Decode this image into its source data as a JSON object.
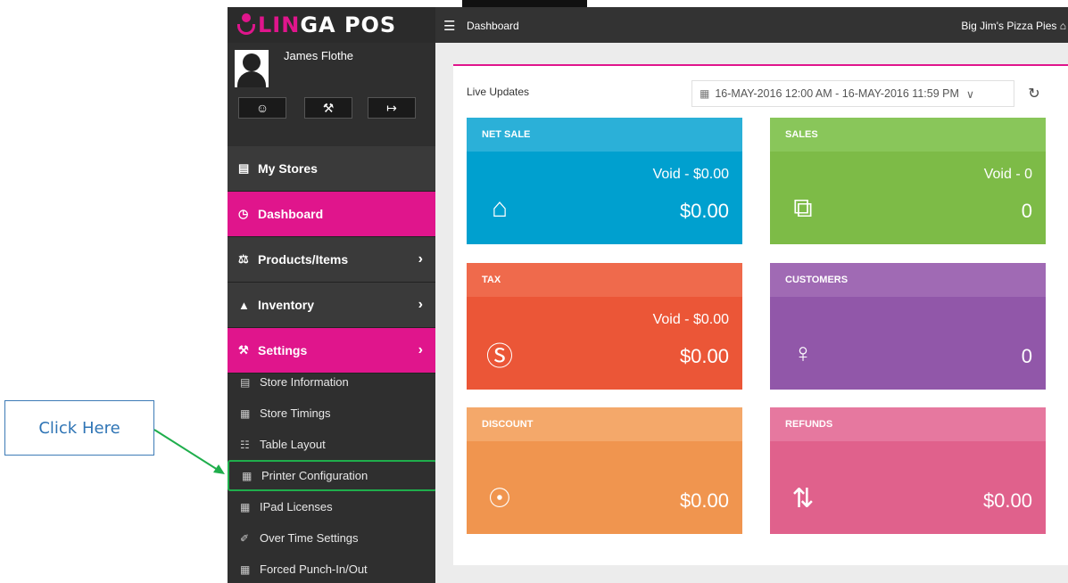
{
  "brand": {
    "part1": "LIN",
    "part2": "GA POS"
  },
  "user": {
    "name": "James Flothe",
    "buttons": [
      "profile",
      "settings",
      "logout"
    ]
  },
  "nav": [
    {
      "label": "My Stores",
      "icon": "store-icon",
      "glyph": "▤",
      "style": "dark",
      "chevron": false
    },
    {
      "label": "Dashboard",
      "icon": "dashboard-icon",
      "glyph": "◷",
      "style": "pink",
      "chevron": false
    },
    {
      "label": "Products/Items",
      "icon": "basket-icon",
      "glyph": "⚖",
      "style": "dark",
      "chevron": true
    },
    {
      "label": "Inventory",
      "icon": "inventory-icon",
      "glyph": "▲",
      "style": "dark",
      "chevron": true
    },
    {
      "label": "Settings",
      "icon": "wrench-icon",
      "glyph": "⚒",
      "style": "pink",
      "chevron": true
    }
  ],
  "settings_submenu": [
    {
      "label": "Store Information",
      "icon": "store-info-icon",
      "glyph": "▤"
    },
    {
      "label": "Store Timings",
      "icon": "timings-icon",
      "glyph": "▦"
    },
    {
      "label": "Table Layout",
      "icon": "table-icon",
      "glyph": "☷"
    },
    {
      "label": "Printer Configuration",
      "icon": "printer-icon",
      "glyph": "▦"
    },
    {
      "label": "IPad Licenses",
      "icon": "ipad-icon",
      "glyph": "▦"
    },
    {
      "label": "Over Time Settings",
      "icon": "overtime-icon",
      "glyph": "✐"
    },
    {
      "label": "Forced Punch-In/Out",
      "icon": "punch-icon",
      "glyph": "▦"
    }
  ],
  "topbar": {
    "breadcrumb": "Dashboard",
    "store": "Big Jim's Pizza Pies"
  },
  "dashboard": {
    "live_updates": "Live Updates",
    "date_range": "16-MAY-2016 12:00 AM - 16-MAY-2016 11:59 PM"
  },
  "cards": [
    {
      "title": "NET SALE",
      "void": "Void - $0.00",
      "amount": "$0.00",
      "head": "#2bb0d8",
      "body": "#00a0cf",
      "icon": "cloche-icon",
      "glyph": "⌂"
    },
    {
      "title": "SALES",
      "void": "Void - 0",
      "amount": "0",
      "head": "#89c65a",
      "body": "#7dbb47",
      "icon": "exchange-icon",
      "glyph": "⧉"
    },
    {
      "title": "TAX",
      "void": "Void - $0.00",
      "amount": "$0.00",
      "head": "#ef6a4c",
      "body": "#eb5637",
      "icon": "moneybag-icon",
      "glyph": "Ⓢ"
    },
    {
      "title": "CUSTOMERS",
      "void": "",
      "amount": "0",
      "head": "#a06ab4",
      "body": "#9157a9",
      "icon": "user-icon",
      "glyph": "♀"
    },
    {
      "title": "DISCOUNT",
      "void": "",
      "amount": "$0.00",
      "head": "#f4a86a",
      "body": "#f0954f",
      "icon": "discount-icon",
      "glyph": "☉"
    },
    {
      "title": "REFUNDS",
      "void": "",
      "amount": "$0.00",
      "head": "#e6789f",
      "body": "#e0618c",
      "icon": "refund-icon",
      "glyph": "⇅"
    }
  ],
  "annotation": {
    "label": "Click Here",
    "border": "#3d7bb6",
    "arrow": "#1fae4c"
  }
}
